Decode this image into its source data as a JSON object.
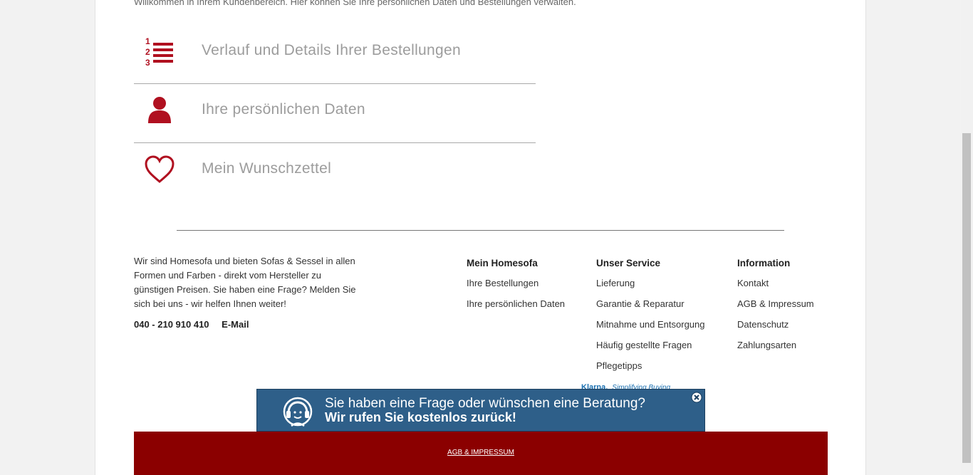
{
  "intro": "Willkommen in Ihrem Kundenbereich. Hier können Sie Ihre persönlichen Daten und Bestellungen verwalten.",
  "account_menu": [
    {
      "label": "Verlauf und Details Ihrer Bestellungen",
      "icon": "numbered-list-icon"
    },
    {
      "label": "Ihre persönlichen Daten",
      "icon": "user-icon"
    },
    {
      "label": "Mein Wunschzettel",
      "icon": "heart-icon"
    }
  ],
  "footer": {
    "about": "Wir sind Homesofa und bieten Sofas & Sessel in allen Formen und Farben - direkt vom Hersteller zu günstigen Preisen. Sie haben eine Frage? Melden Sie sich bei uns - wir helfen Ihnen weiter!",
    "phone": "040 - 210 910 410",
    "email_label": "E-Mail",
    "columns": [
      {
        "title": "Mein Homesofa",
        "links": [
          "Ihre Bestellungen",
          "Ihre persönlichen Daten"
        ]
      },
      {
        "title": "Unser Service",
        "links": [
          "Lieferung",
          "Garantie & Reparatur",
          "Mitnahme und Entsorgung",
          "Häufig gestellte Fragen",
          "Pflegetipps"
        ]
      },
      {
        "title": "Information",
        "links": [
          "Kontakt",
          "AGB & Impressum",
          "Datenschutz",
          "Zahlungsarten"
        ]
      }
    ],
    "klarna_brand": "Klarna.",
    "klarna_tagline": "Simplifying Buying"
  },
  "callback_banner": {
    "line1": "Sie haben eine Frage oder wünschen eine Beratung?",
    "line2": "Wir rufen Sie kostenlos zurück!"
  },
  "bottom_bar": {
    "link": "AGB & IMPRESSUM"
  },
  "colors": {
    "brand_red": "#b01020",
    "bar_red": "#8b0000",
    "banner_blue": "#2e5f89"
  }
}
